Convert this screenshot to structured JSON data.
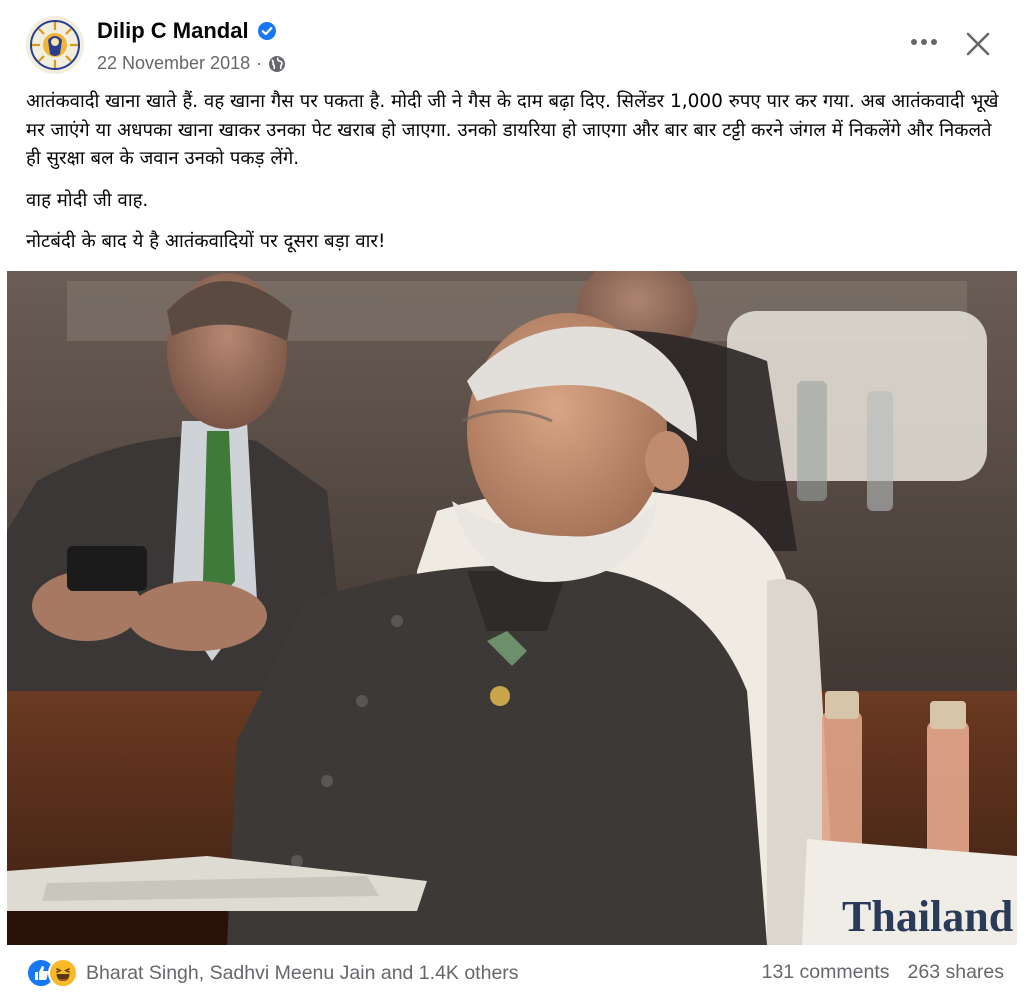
{
  "post": {
    "author": "Dilip C Mandal",
    "date": "22 November 2018",
    "privacy_icon": "globe-icon",
    "verified_icon": "verified-badge-icon",
    "text": [
      "आतंकवादी खाना खाते हैं. वह खाना गैस पर पकता है. मोदी जी ने गैस के दाम बढ़ा दिए. सिलेंडर 1,000 रुपए पार कर गया. अब आतंकवादी भूखे मर जाएंगे या अधपका खाना खाकर उनका पेट खराब हो जाएगा. उनको डायरिया हो जाएगा और बार बार टट्टी करने जंगल में निकलेंगे और निकलते ही सुरक्षा बल के जवान उनको पकड़ लेंगे.",
      "वाह मोदी जी वाह.",
      "नोटबंदी के बाद ये है आतंकवादियों पर दूसरा बड़ा वार!"
    ],
    "photo": {
      "place_card_text": "Thailand"
    }
  },
  "header_actions": {
    "more_icon": "more-options-icon",
    "close_icon": "close-icon"
  },
  "footer": {
    "reaction_icons": [
      "like-icon",
      "haha-icon"
    ],
    "reactions_text": "Bharat Singh, Sadhvi Meenu Jain and 1.4K others",
    "comments": "131 comments",
    "shares": "263 shares"
  },
  "colors": {
    "link_blue": "#1877f2",
    "secondary_text": "#65676b",
    "primary_text": "#050505",
    "haha_yellow": "#f7b928"
  }
}
